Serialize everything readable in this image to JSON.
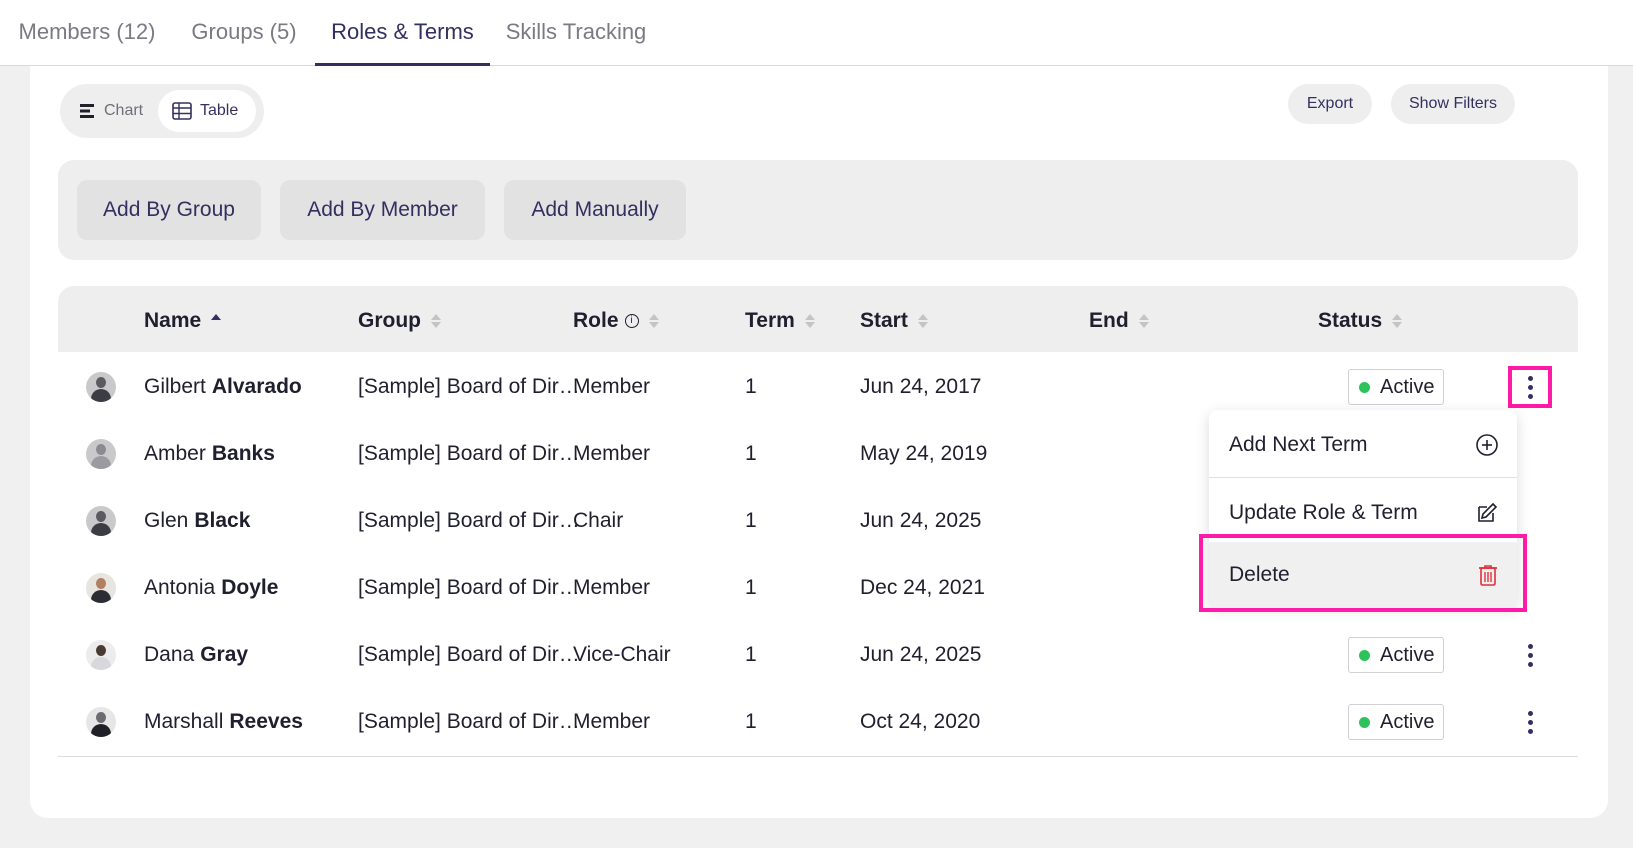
{
  "tabs": [
    {
      "label": "Members (12)"
    },
    {
      "label": "Groups (5)"
    },
    {
      "label": "Roles & Terms"
    },
    {
      "label": "Skills Tracking"
    }
  ],
  "view_toggle": {
    "chart": "Chart",
    "table": "Table"
  },
  "toolbar": {
    "export": "Export",
    "filters": "Show Filters"
  },
  "add_bar": {
    "by_group": "Add By Group",
    "by_member": "Add By Member",
    "manually": "Add Manually"
  },
  "columns": {
    "name": "Name",
    "group": "Group",
    "role": "Role",
    "role_info": "i",
    "term": "Term",
    "start": "Start",
    "end": "End",
    "status": "Status"
  },
  "rows": [
    {
      "first": "Gilbert",
      "last": "Alvarado",
      "group": "[Sample] Board of Dir…",
      "role": "Member",
      "term": "1",
      "start": "Jun 24, 2017",
      "end": "",
      "status": "Active"
    },
    {
      "first": "Amber",
      "last": "Banks",
      "group": "[Sample] Board of Dir…",
      "role": "Member",
      "term": "1",
      "start": "May 24, 2019",
      "end": "",
      "status": ""
    },
    {
      "first": "Glen",
      "last": "Black",
      "group": "[Sample] Board of Dir…",
      "role": "Chair",
      "term": "1",
      "start": "Jun 24, 2025",
      "end": "",
      "status": ""
    },
    {
      "first": "Antonia",
      "last": "Doyle",
      "group": "[Sample] Board of Dir…",
      "role": "Member",
      "term": "1",
      "start": "Dec 24, 2021",
      "end": "",
      "status": ""
    },
    {
      "first": "Dana",
      "last": "Gray",
      "group": "[Sample] Board of Dir…",
      "role": "Vice-Chair",
      "term": "1",
      "start": "Jun 24, 2025",
      "end": "",
      "status": "Active"
    },
    {
      "first": "Marshall",
      "last": "Reeves",
      "group": "[Sample] Board of Dir…",
      "role": "Member",
      "term": "1",
      "start": "Oct 24, 2020",
      "end": "",
      "status": "Active"
    }
  ],
  "menu": {
    "add_next_term": "Add Next Term",
    "update": "Update Role & Term",
    "delete": "Delete"
  },
  "colors": {
    "accent": "#33305f",
    "highlight": "#ff1aa8",
    "active_dot": "#2ec25a",
    "delete_icon": "#e0303a"
  },
  "icons": {
    "chart": "bar-chart-icon",
    "table": "table-icon",
    "info": "info-icon",
    "add": "plus-circle-icon",
    "edit": "edit-icon",
    "delete": "trash-icon",
    "more": "more-vertical-icon"
  }
}
